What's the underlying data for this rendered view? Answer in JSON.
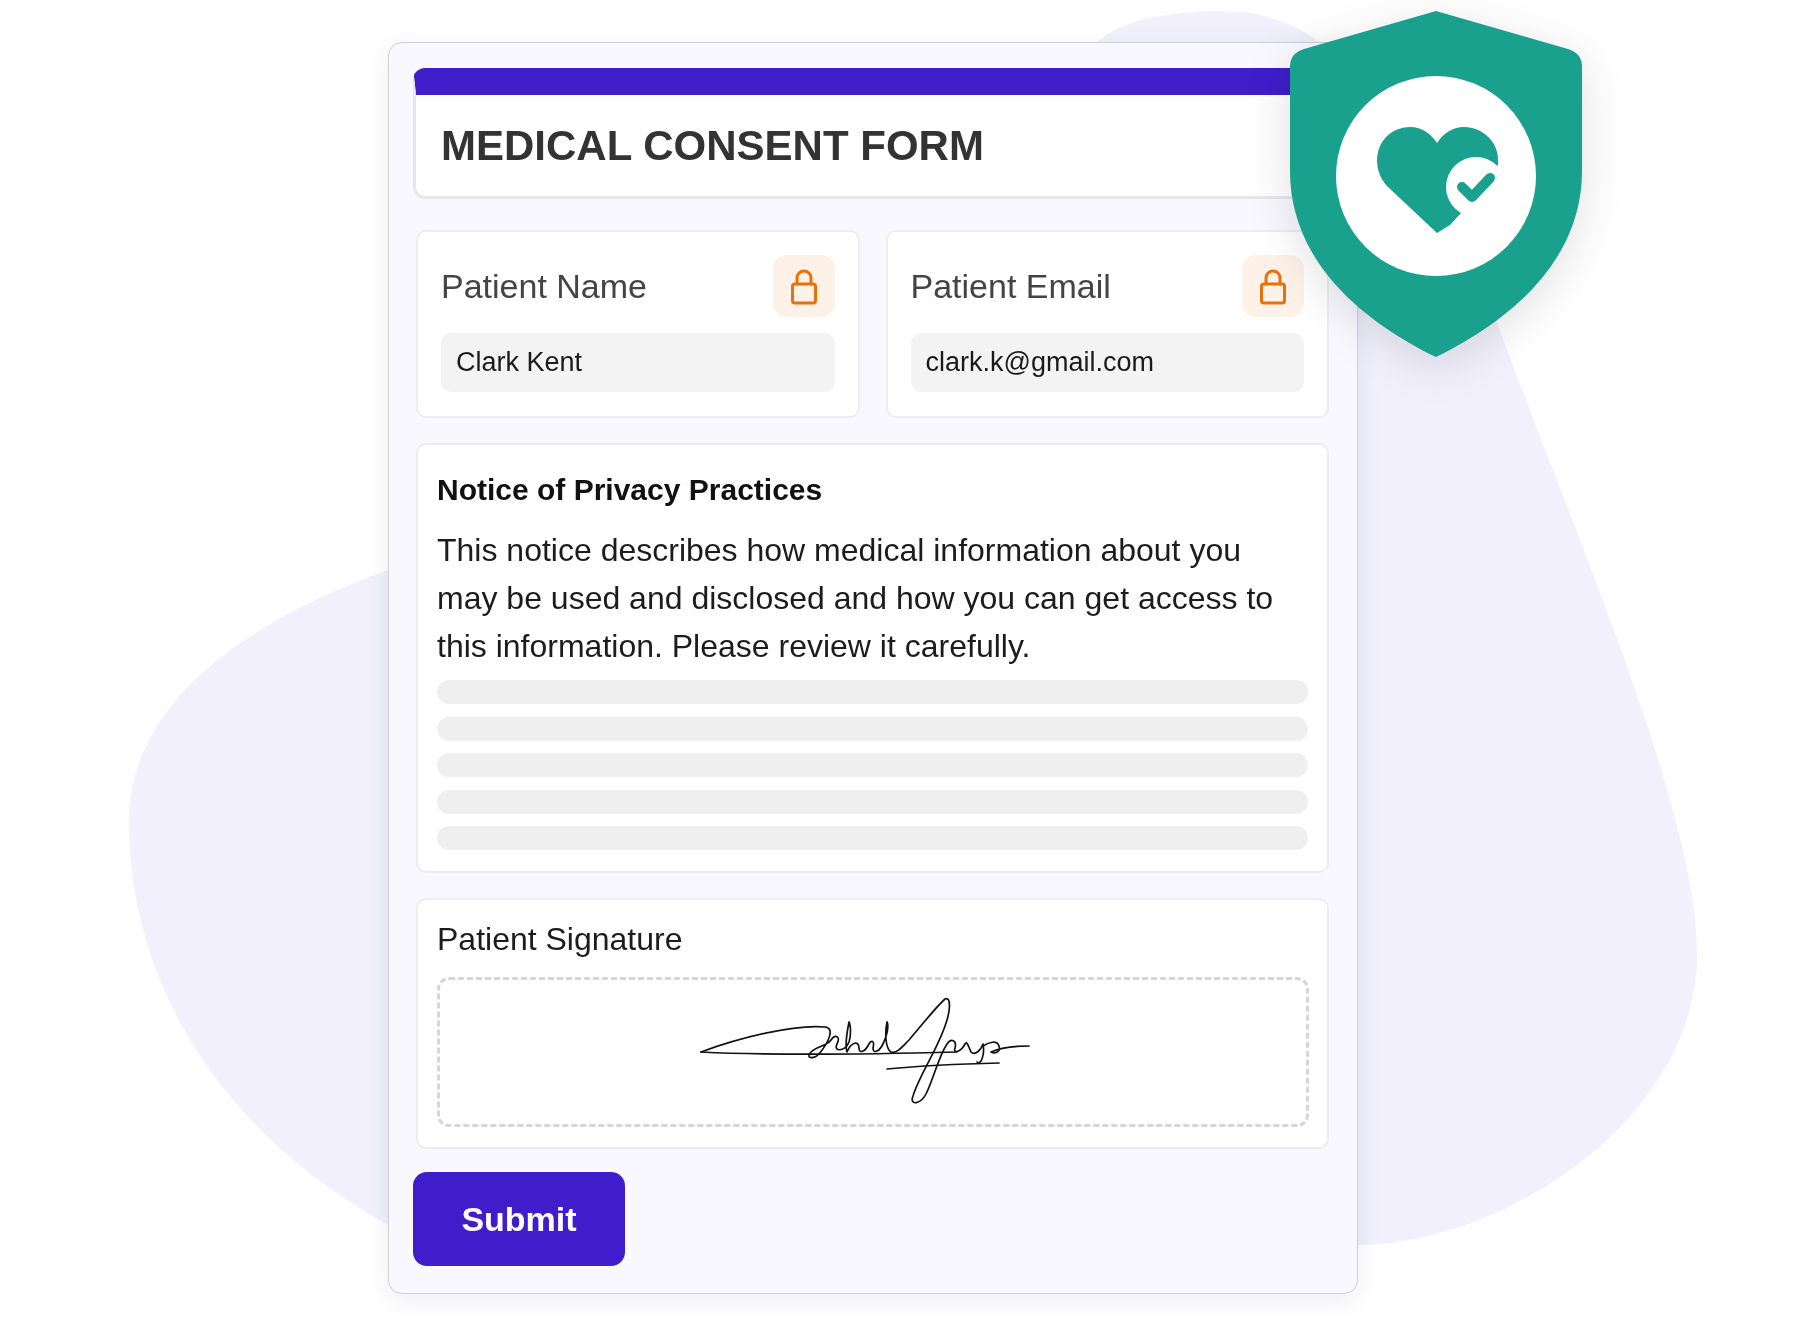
{
  "form": {
    "title": "MEDICAL CONSENT FORM"
  },
  "fields": [
    {
      "label": "Patient Name",
      "value": "Clark Kent",
      "locked": true
    },
    {
      "label": "Patient Email",
      "value": "clark.k@gmail.com",
      "locked": true
    }
  ],
  "notice": {
    "heading": "Notice of Privacy Practices",
    "body": "This notice describes how medical information about you may be used and disclosed and how you can get access to this information. Please review it carefully."
  },
  "signature": {
    "label": "Patient Signature",
    "signed": true
  },
  "submit": {
    "label": "Submit"
  }
}
